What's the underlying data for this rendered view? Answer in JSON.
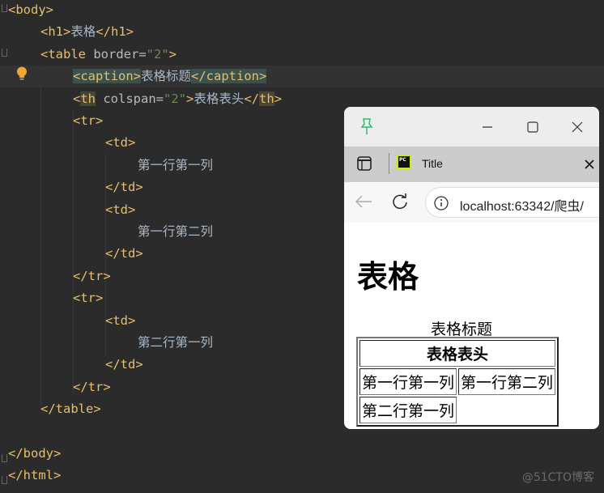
{
  "editor": {
    "lines": [
      {
        "indent": 0,
        "tokens": [
          [
            "tag",
            "<body>"
          ]
        ]
      },
      {
        "indent": 4,
        "tokens": [
          [
            "tag",
            "<h1>"
          ],
          [
            "txt",
            "表格"
          ],
          [
            "tag",
            "</h1>"
          ]
        ]
      },
      {
        "indent": 4,
        "tokens": [
          [
            "tag",
            "<table "
          ],
          [
            "attr",
            "border="
          ],
          [
            "val",
            "\"2\""
          ],
          [
            "tag",
            ">"
          ]
        ]
      },
      {
        "indent": 8,
        "active": true,
        "tokens": [
          [
            "tag hl",
            "<caption>"
          ],
          [
            "txt",
            "表格标题"
          ],
          [
            "tag hl",
            "</caption>"
          ]
        ]
      },
      {
        "indent": 8,
        "tokens": [
          [
            "tag",
            "<"
          ],
          [
            "tag hl2",
            "th"
          ],
          [
            "attr",
            " colspan="
          ],
          [
            "val",
            "\"2\""
          ],
          [
            "tag",
            ">"
          ],
          [
            "txt",
            "表格表头"
          ],
          [
            "tag",
            "</"
          ],
          [
            "tag hl2",
            "th"
          ],
          [
            "tag",
            ">"
          ]
        ]
      },
      {
        "indent": 8,
        "tokens": [
          [
            "tag",
            "<tr>"
          ]
        ]
      },
      {
        "indent": 12,
        "tokens": [
          [
            "tag",
            "<td>"
          ]
        ]
      },
      {
        "indent": 16,
        "tokens": [
          [
            "txt",
            "第一行第一列"
          ]
        ]
      },
      {
        "indent": 12,
        "tokens": [
          [
            "tag",
            "</td>"
          ]
        ]
      },
      {
        "indent": 12,
        "tokens": [
          [
            "tag",
            "<td>"
          ]
        ]
      },
      {
        "indent": 16,
        "tokens": [
          [
            "txt",
            "第一行第二列"
          ]
        ]
      },
      {
        "indent": 12,
        "tokens": [
          [
            "tag",
            "</td>"
          ]
        ]
      },
      {
        "indent": 8,
        "tokens": [
          [
            "tag",
            "</tr>"
          ]
        ]
      },
      {
        "indent": 8,
        "tokens": [
          [
            "tag",
            "<tr>"
          ]
        ]
      },
      {
        "indent": 12,
        "tokens": [
          [
            "tag",
            "<td>"
          ]
        ]
      },
      {
        "indent": 16,
        "tokens": [
          [
            "txt",
            "第二行第一列"
          ]
        ]
      },
      {
        "indent": 12,
        "tokens": [
          [
            "tag",
            "</td>"
          ]
        ]
      },
      {
        "indent": 8,
        "tokens": [
          [
            "tag",
            "</tr>"
          ]
        ]
      },
      {
        "indent": 4,
        "tokens": [
          [
            "tag",
            "</table>"
          ]
        ]
      },
      {
        "indent": 0,
        "tokens": []
      },
      {
        "indent": 0,
        "tokens": [
          [
            "tag",
            "</body>"
          ]
        ]
      },
      {
        "indent": 0,
        "tokens": [
          [
            "tag",
            "</html>"
          ]
        ]
      }
    ]
  },
  "browser": {
    "tab_title": "Title",
    "address": "localhost:63342/爬虫/",
    "page": {
      "h1": "表格",
      "caption": "表格标题",
      "th": "表格表头",
      "rows": [
        [
          "第一行第一列",
          "第一行第二列"
        ],
        [
          "第二行第一列"
        ]
      ]
    }
  },
  "watermark": "@51CTO博客",
  "colors": {
    "tag": "#e8bf6a",
    "value": "#6a8759",
    "text": "#a9b7c6",
    "editor_bg": "#2b2b2b"
  }
}
